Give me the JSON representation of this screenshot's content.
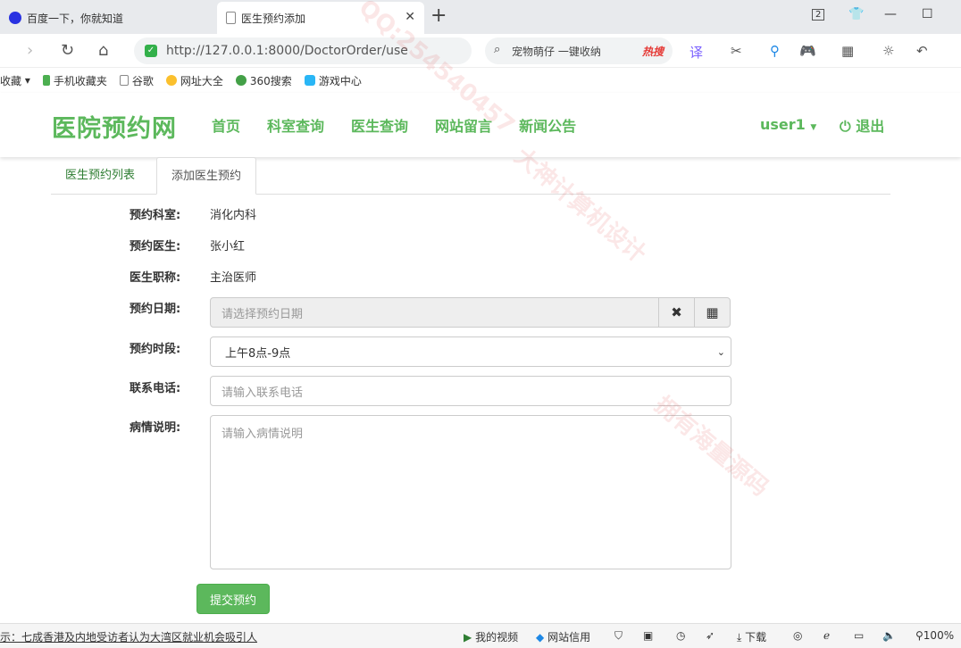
{
  "browser": {
    "tabs": [
      {
        "title": "百度一下，你就知道"
      },
      {
        "title": "医生预约添加"
      }
    ],
    "tab_count": "2",
    "url": "http://127.0.0.1:8000/DoctorOrder/use",
    "search_text": "宠物萌仔 一键收纳",
    "hot_label": "热搜",
    "bookmarks": [
      "收藏",
      "手机收藏夹",
      "谷歌",
      "网址大全",
      "360搜索",
      "游戏中心"
    ]
  },
  "site": {
    "logo": "医院预约网",
    "nav": [
      "首页",
      "科室查询",
      "医生查询",
      "网站留言",
      "新闻公告"
    ],
    "user": "user1",
    "logout": "退出"
  },
  "tabs": [
    "医生预约列表",
    "添加医生预约"
  ],
  "form": {
    "dept_label": "预约科室:",
    "dept_value": "消化内科",
    "doctor_label": "预约医生:",
    "doctor_value": "张小红",
    "title_label": "医生职称:",
    "title_value": "主治医师",
    "date_label": "预约日期:",
    "date_placeholder": "请选择预约日期",
    "period_label": "预约时段:",
    "period_value": "上午8点-9点",
    "phone_label": "联系电话:",
    "phone_placeholder": "请输入联系电话",
    "desc_label": "病情说明:",
    "desc_placeholder": "请输入病情说明",
    "submit": "提交预约"
  },
  "statusbar": {
    "news": "示：七成香港及内地受访者认为大湾区就业机会吸引人",
    "video": "我的视频",
    "credit": "网站信用",
    "download": "下载",
    "zoom": "100%"
  },
  "watermark": [
    "QQ:254540457",
    "大神计算机设计",
    "拥有海量源码"
  ],
  "colors": {
    "accent": "#5cb85c",
    "tab_active": "#2e7d32"
  }
}
